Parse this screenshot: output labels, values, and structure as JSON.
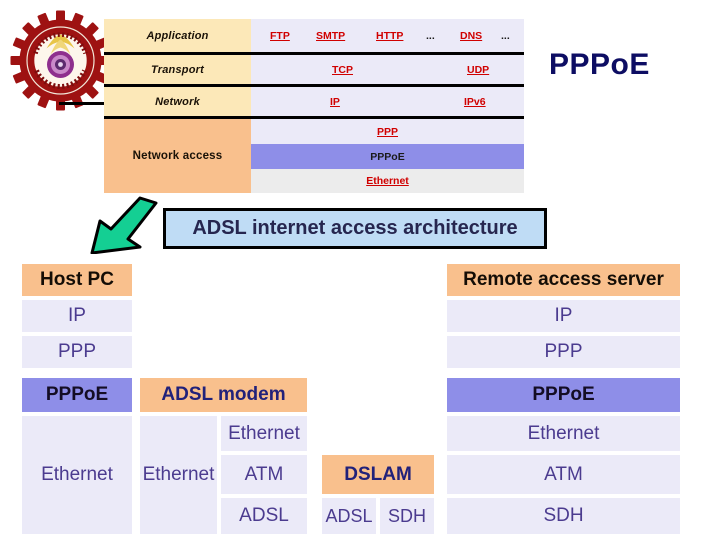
{
  "logo": {
    "name": "university-seal",
    "alt": "University seal emblem"
  },
  "title": {
    "text": "PPPoE",
    "color": "#0d0d63"
  },
  "banner": {
    "text": "ADSL internet access architecture"
  },
  "arrow": {
    "name": "green-arrow-down-left",
    "fill": "#14cf93"
  },
  "stack_table": {
    "layers": [
      {
        "name": "Application",
        "protocols": [
          "FTP",
          "SMTP",
          "HTTP",
          "...",
          "DNS",
          "..."
        ]
      },
      {
        "name": "Transport",
        "protocols": [
          "TCP",
          "UDP"
        ]
      },
      {
        "name": "Network",
        "protocols": [
          "IP",
          "IPv6"
        ]
      },
      {
        "name": "Network access",
        "protocols": [
          "PPP",
          "PPPoE",
          "Ethernet"
        ]
      }
    ],
    "app_protocols": {
      "p1": "FTP",
      "p2": "SMTP",
      "p3": "HTTP",
      "p4": "...",
      "p5": "DNS",
      "p6": "..."
    },
    "transport_protocols": {
      "p1": "TCP",
      "p2": "UDP"
    },
    "network_protocols": {
      "p1": "IP",
      "p2": "IPv6"
    },
    "access_rows": {
      "r1": "PPP",
      "r2": "PPPoE",
      "r3": "Ethernet"
    },
    "layer_labels": {
      "application": "Application",
      "transport": "Transport",
      "network": "Network",
      "network_access": "Network access"
    },
    "colors": {
      "layer_cell": "#fce8b8",
      "access_cell": "#f9c08d",
      "protocol_cell": "#ebeaf8",
      "pppoe_highlight": "#8e8ee8",
      "ethernet_cell": "#ececec",
      "protocol_text": "#d00000"
    }
  },
  "architecture": {
    "host_pc": {
      "label": "Host PC",
      "layers": [
        "IP",
        "PPP",
        "PPPoE",
        "Ethernet"
      ],
      "l1": "IP",
      "l2": "PPP",
      "l3": "PPPoE",
      "l4": "Ethernet"
    },
    "adsl_modem": {
      "label": "ADSL modem",
      "left_column": {
        "l1": "Ethernet"
      },
      "right_column": {
        "l1": "Ethernet",
        "l2": "ATM",
        "l3": "ADSL"
      }
    },
    "dslam": {
      "label": "DSLAM",
      "l1": "ADSL",
      "l2": "SDH"
    },
    "remote_access_server": {
      "label": "Remote access server",
      "layers": [
        "IP",
        "PPP",
        "PPPoE",
        "Ethernet",
        "ATM",
        "SDH"
      ],
      "l1": "IP",
      "l2": "PPP",
      "l3": "PPPoE",
      "l4": "Ethernet",
      "l5": "ATM",
      "l6": "SDH"
    }
  }
}
